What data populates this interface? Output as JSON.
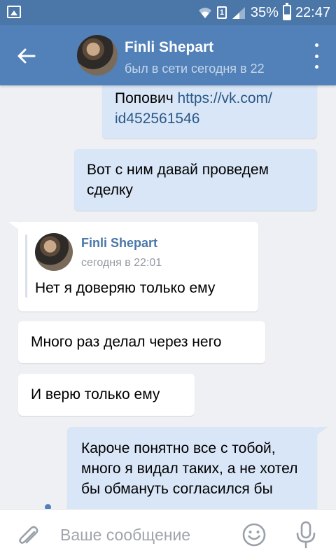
{
  "status_bar": {
    "battery": "35%",
    "time": "22:47",
    "sim": "1",
    "icons": [
      "gallery-icon",
      "wifi-icon",
      "sim-icon",
      "signal-icon",
      "battery-icon"
    ]
  },
  "header": {
    "name": "Finli Shepart",
    "status": "был в сети сегодня в 22",
    "icons": [
      "back-arrow-icon",
      "more-vertical-icon"
    ]
  },
  "messages": [
    {
      "direction": "out",
      "text": "Попович",
      "link": "https://vk.com/ id452561546"
    },
    {
      "direction": "out",
      "text": "Вот с ним давай проведем сделку"
    },
    {
      "direction": "in",
      "forwarded": {
        "author": "Finli Shepart",
        "time": "сегодня в 22:01",
        "text": "Нет я доверяю только ему"
      }
    },
    {
      "direction": "in",
      "text": "Много раз делал через него"
    },
    {
      "direction": "in",
      "text": "И верю только ему"
    },
    {
      "direction": "out",
      "text": "Кароче понятно все с тобой, много я видал таких, а не хотел бы обмануть согласился бы"
    }
  ],
  "composer": {
    "placeholder": "Ваше сообщение",
    "value": "",
    "icons": [
      "paperclip-icon",
      "emoji-icon",
      "microphone-icon"
    ]
  },
  "colors": {
    "header": "#5181b8",
    "status_bar": "#4a76a8",
    "outgoing_bubble": "#d9e6f7",
    "incoming_bubble": "#ffffff",
    "chat_background": "#eef0f3",
    "link": "#2a5885"
  }
}
